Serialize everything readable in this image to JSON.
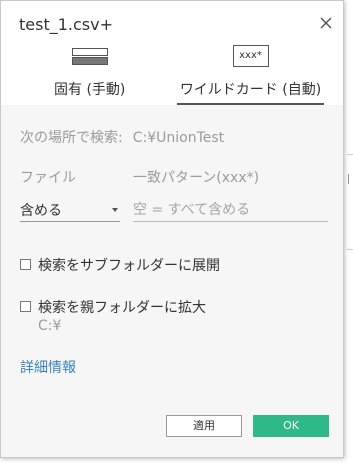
{
  "dialog": {
    "title": "test_1.csv+"
  },
  "tabs": [
    {
      "label": "固有 (手動)",
      "icon": "fixed-width-icon"
    },
    {
      "label": "ワイルドカード (自動)",
      "icon": "wildcard-icon",
      "icon_text": "xxx*",
      "selected": true
    }
  ],
  "location": {
    "label": "次の場所で検索:",
    "value": "C:¥UnionTest"
  },
  "file": {
    "label": "ファイル",
    "select_value": "含める"
  },
  "pattern": {
    "label": "一致パターン(xxx*)",
    "placeholder": "空 = すべて含める"
  },
  "options": {
    "expand_subfolders": "検索をサブフォルダーに展開",
    "expand_parent": "検索を親フォルダーに拡大",
    "parent_path": "C:¥"
  },
  "details_link": "詳細情報",
  "buttons": {
    "apply": "適用",
    "ok": "OK"
  },
  "colors": {
    "ok_button": "#2fb989",
    "link": "#3b80b8",
    "body_bg": "#f6f6f6"
  }
}
